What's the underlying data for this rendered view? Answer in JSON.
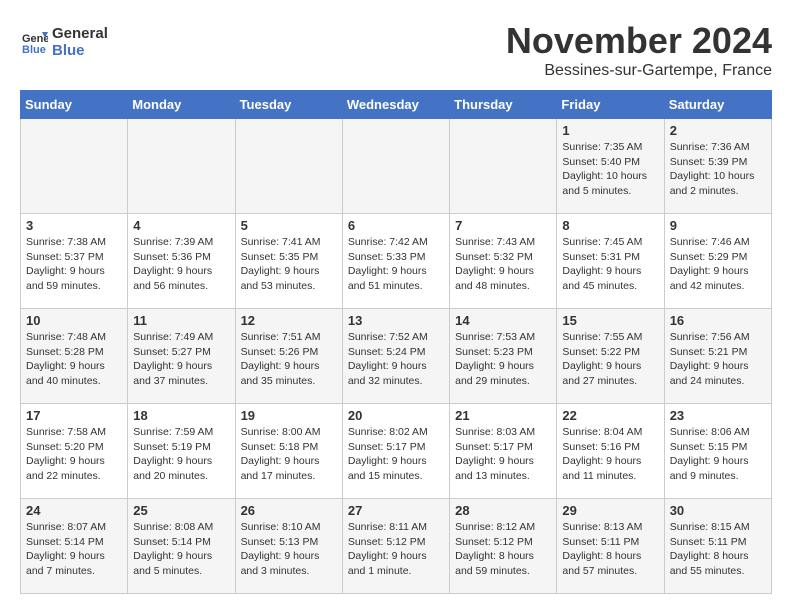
{
  "header": {
    "logo_line1": "General",
    "logo_line2": "Blue",
    "title": "November 2024",
    "subtitle": "Bessines-sur-Gartempe, France"
  },
  "days_of_week": [
    "Sunday",
    "Monday",
    "Tuesday",
    "Wednesday",
    "Thursday",
    "Friday",
    "Saturday"
  ],
  "weeks": [
    [
      {
        "day": "",
        "content": ""
      },
      {
        "day": "",
        "content": ""
      },
      {
        "day": "",
        "content": ""
      },
      {
        "day": "",
        "content": ""
      },
      {
        "day": "",
        "content": ""
      },
      {
        "day": "1",
        "content": "Sunrise: 7:35 AM\nSunset: 5:40 PM\nDaylight: 10 hours\nand 5 minutes."
      },
      {
        "day": "2",
        "content": "Sunrise: 7:36 AM\nSunset: 5:39 PM\nDaylight: 10 hours\nand 2 minutes."
      }
    ],
    [
      {
        "day": "3",
        "content": "Sunrise: 7:38 AM\nSunset: 5:37 PM\nDaylight: 9 hours\nand 59 minutes."
      },
      {
        "day": "4",
        "content": "Sunrise: 7:39 AM\nSunset: 5:36 PM\nDaylight: 9 hours\nand 56 minutes."
      },
      {
        "day": "5",
        "content": "Sunrise: 7:41 AM\nSunset: 5:35 PM\nDaylight: 9 hours\nand 53 minutes."
      },
      {
        "day": "6",
        "content": "Sunrise: 7:42 AM\nSunset: 5:33 PM\nDaylight: 9 hours\nand 51 minutes."
      },
      {
        "day": "7",
        "content": "Sunrise: 7:43 AM\nSunset: 5:32 PM\nDaylight: 9 hours\nand 48 minutes."
      },
      {
        "day": "8",
        "content": "Sunrise: 7:45 AM\nSunset: 5:31 PM\nDaylight: 9 hours\nand 45 minutes."
      },
      {
        "day": "9",
        "content": "Sunrise: 7:46 AM\nSunset: 5:29 PM\nDaylight: 9 hours\nand 42 minutes."
      }
    ],
    [
      {
        "day": "10",
        "content": "Sunrise: 7:48 AM\nSunset: 5:28 PM\nDaylight: 9 hours\nand 40 minutes."
      },
      {
        "day": "11",
        "content": "Sunrise: 7:49 AM\nSunset: 5:27 PM\nDaylight: 9 hours\nand 37 minutes."
      },
      {
        "day": "12",
        "content": "Sunrise: 7:51 AM\nSunset: 5:26 PM\nDaylight: 9 hours\nand 35 minutes."
      },
      {
        "day": "13",
        "content": "Sunrise: 7:52 AM\nSunset: 5:24 PM\nDaylight: 9 hours\nand 32 minutes."
      },
      {
        "day": "14",
        "content": "Sunrise: 7:53 AM\nSunset: 5:23 PM\nDaylight: 9 hours\nand 29 minutes."
      },
      {
        "day": "15",
        "content": "Sunrise: 7:55 AM\nSunset: 5:22 PM\nDaylight: 9 hours\nand 27 minutes."
      },
      {
        "day": "16",
        "content": "Sunrise: 7:56 AM\nSunset: 5:21 PM\nDaylight: 9 hours\nand 24 minutes."
      }
    ],
    [
      {
        "day": "17",
        "content": "Sunrise: 7:58 AM\nSunset: 5:20 PM\nDaylight: 9 hours\nand 22 minutes."
      },
      {
        "day": "18",
        "content": "Sunrise: 7:59 AM\nSunset: 5:19 PM\nDaylight: 9 hours\nand 20 minutes."
      },
      {
        "day": "19",
        "content": "Sunrise: 8:00 AM\nSunset: 5:18 PM\nDaylight: 9 hours\nand 17 minutes."
      },
      {
        "day": "20",
        "content": "Sunrise: 8:02 AM\nSunset: 5:17 PM\nDaylight: 9 hours\nand 15 minutes."
      },
      {
        "day": "21",
        "content": "Sunrise: 8:03 AM\nSunset: 5:17 PM\nDaylight: 9 hours\nand 13 minutes."
      },
      {
        "day": "22",
        "content": "Sunrise: 8:04 AM\nSunset: 5:16 PM\nDaylight: 9 hours\nand 11 minutes."
      },
      {
        "day": "23",
        "content": "Sunrise: 8:06 AM\nSunset: 5:15 PM\nDaylight: 9 hours\nand 9 minutes."
      }
    ],
    [
      {
        "day": "24",
        "content": "Sunrise: 8:07 AM\nSunset: 5:14 PM\nDaylight: 9 hours\nand 7 minutes."
      },
      {
        "day": "25",
        "content": "Sunrise: 8:08 AM\nSunset: 5:14 PM\nDaylight: 9 hours\nand 5 minutes."
      },
      {
        "day": "26",
        "content": "Sunrise: 8:10 AM\nSunset: 5:13 PM\nDaylight: 9 hours\nand 3 minutes."
      },
      {
        "day": "27",
        "content": "Sunrise: 8:11 AM\nSunset: 5:12 PM\nDaylight: 9 hours\nand 1 minute."
      },
      {
        "day": "28",
        "content": "Sunrise: 8:12 AM\nSunset: 5:12 PM\nDaylight: 8 hours\nand 59 minutes."
      },
      {
        "day": "29",
        "content": "Sunrise: 8:13 AM\nSunset: 5:11 PM\nDaylight: 8 hours\nand 57 minutes."
      },
      {
        "day": "30",
        "content": "Sunrise: 8:15 AM\nSunset: 5:11 PM\nDaylight: 8 hours\nand 55 minutes."
      }
    ]
  ]
}
